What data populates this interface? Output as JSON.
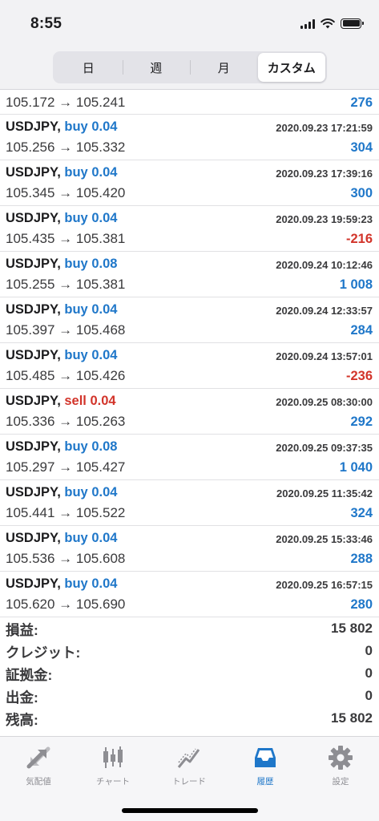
{
  "status": {
    "time": "8:55"
  },
  "segments": [
    "日",
    "週",
    "月",
    "カスタム"
  ],
  "first_row": {
    "prices": "105.172 → 105.241",
    "profit": "276",
    "sign": "pos"
  },
  "deals": [
    {
      "symbol": "USDJPY,",
      "side": "buy",
      "volume": "0.04",
      "time": "2020.09.23 17:21:59",
      "prices": "105.256 → 105.332",
      "profit": "304",
      "sign": "pos"
    },
    {
      "symbol": "USDJPY,",
      "side": "buy",
      "volume": "0.04",
      "time": "2020.09.23 17:39:16",
      "prices": "105.345 → 105.420",
      "profit": "300",
      "sign": "pos"
    },
    {
      "symbol": "USDJPY,",
      "side": "buy",
      "volume": "0.04",
      "time": "2020.09.23 19:59:23",
      "prices": "105.435 → 105.381",
      "profit": "-216",
      "sign": "neg"
    },
    {
      "symbol": "USDJPY,",
      "side": "buy",
      "volume": "0.08",
      "time": "2020.09.24 10:12:46",
      "prices": "105.255 → 105.381",
      "profit": "1 008",
      "sign": "pos"
    },
    {
      "symbol": "USDJPY,",
      "side": "buy",
      "volume": "0.04",
      "time": "2020.09.24 12:33:57",
      "prices": "105.397 → 105.468",
      "profit": "284",
      "sign": "pos"
    },
    {
      "symbol": "USDJPY,",
      "side": "buy",
      "volume": "0.04",
      "time": "2020.09.24 13:57:01",
      "prices": "105.485 → 105.426",
      "profit": "-236",
      "sign": "neg"
    },
    {
      "symbol": "USDJPY,",
      "side": "sell",
      "volume": "0.04",
      "time": "2020.09.25 08:30:00",
      "prices": "105.336 → 105.263",
      "profit": "292",
      "sign": "pos"
    },
    {
      "symbol": "USDJPY,",
      "side": "buy",
      "volume": "0.08",
      "time": "2020.09.25 09:37:35",
      "prices": "105.297 → 105.427",
      "profit": "1 040",
      "sign": "pos"
    },
    {
      "symbol": "USDJPY,",
      "side": "buy",
      "volume": "0.04",
      "time": "2020.09.25 11:35:42",
      "prices": "105.441 → 105.522",
      "profit": "324",
      "sign": "pos"
    },
    {
      "symbol": "USDJPY,",
      "side": "buy",
      "volume": "0.04",
      "time": "2020.09.25 15:33:46",
      "prices": "105.536 → 105.608",
      "profit": "288",
      "sign": "pos"
    },
    {
      "symbol": "USDJPY,",
      "side": "buy",
      "volume": "0.04",
      "time": "2020.09.25 16:57:15",
      "prices": "105.620 → 105.690",
      "profit": "280",
      "sign": "pos"
    }
  ],
  "summary": [
    {
      "label": "損益:",
      "value": "15 802"
    },
    {
      "label": "クレジット:",
      "value": "0"
    },
    {
      "label": "証拠金:",
      "value": "0"
    },
    {
      "label": "出金:",
      "value": "0"
    },
    {
      "label": "残高:",
      "value": "15 802"
    }
  ],
  "tabs": [
    {
      "label": "気配値",
      "icon": "quotes-arrows-icon"
    },
    {
      "label": "チャート",
      "icon": "candlestick-chart-icon"
    },
    {
      "label": "トレード",
      "icon": "trade-line-icon"
    },
    {
      "label": "履歴",
      "icon": "inbox-tray-icon",
      "active": true
    },
    {
      "label": "設定",
      "icon": "gear-icon"
    }
  ],
  "colors": {
    "buy": "#1f77c9",
    "sell": "#d2342a",
    "profit_positive": "#1f77c9",
    "profit_negative": "#d2342a",
    "active_tab": "#1f77c9",
    "inactive_tab": "#8e8e93"
  }
}
